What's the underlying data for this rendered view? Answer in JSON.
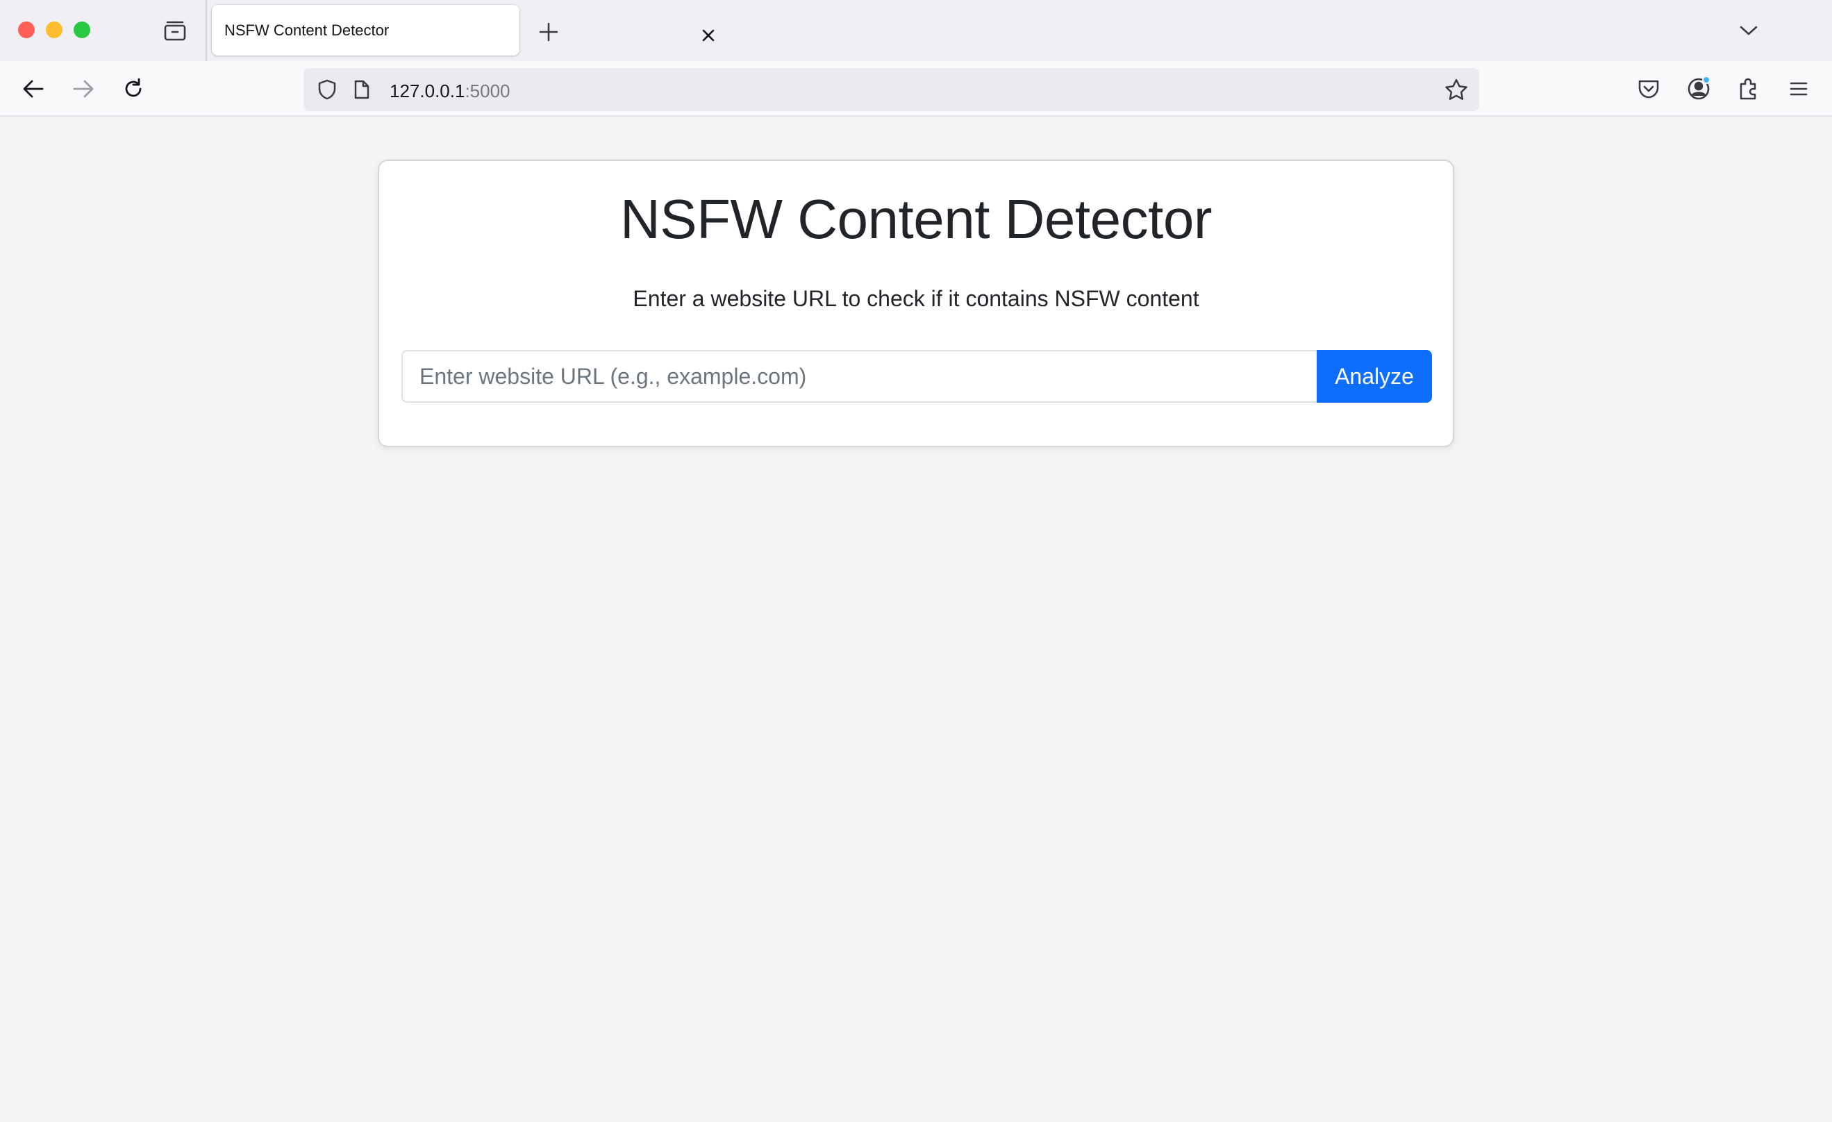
{
  "browser": {
    "tab": {
      "title": "NSFW Content Detector"
    },
    "url": {
      "host": "127.0.0.1",
      "port": ":5000"
    }
  },
  "page": {
    "title": "NSFW Content Detector",
    "subtitle": "Enter a website URL to check if it contains NSFW content",
    "input": {
      "placeholder": "Enter website URL (e.g., example.com)",
      "value": ""
    },
    "button_label": "Analyze"
  },
  "colors": {
    "primary_button": "#0d6efd",
    "page_background": "#f4f4f5",
    "text": "#212529"
  }
}
